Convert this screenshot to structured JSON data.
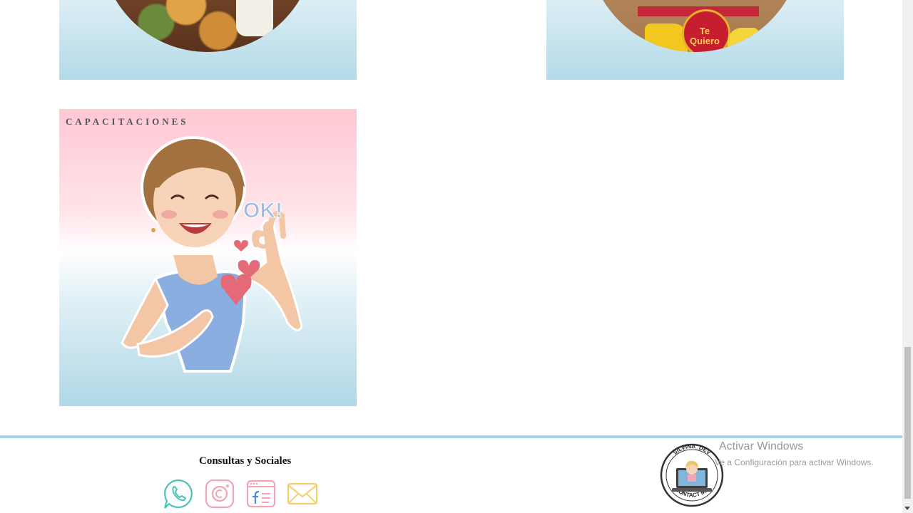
{
  "cards": {
    "top_right_photo_text": "Te Quiero",
    "capacitaciones": {
      "title": "CAPACITACIONES",
      "speech": "OK!"
    }
  },
  "footer": {
    "title": "Consultas y Sociales",
    "social_icons": [
      "whatsapp-icon",
      "instagram-icon",
      "facebook-icon",
      "email-icon"
    ],
    "badge_top_text": "SILVINA_DEV",
    "badge_bottom_text": "CONTACT ME"
  },
  "windows_watermark": {
    "title": "Activar Windows",
    "subtitle": "Ve a Configuración para activar Windows."
  },
  "colors": {
    "pink": "#ffc8d3",
    "light_blue": "#b0d8e6",
    "footer_border": "#a9d5e2",
    "icon_teal": "#4cc3b5",
    "icon_pink": "#f2a5b6",
    "icon_yellow": "#f5cf6e"
  }
}
